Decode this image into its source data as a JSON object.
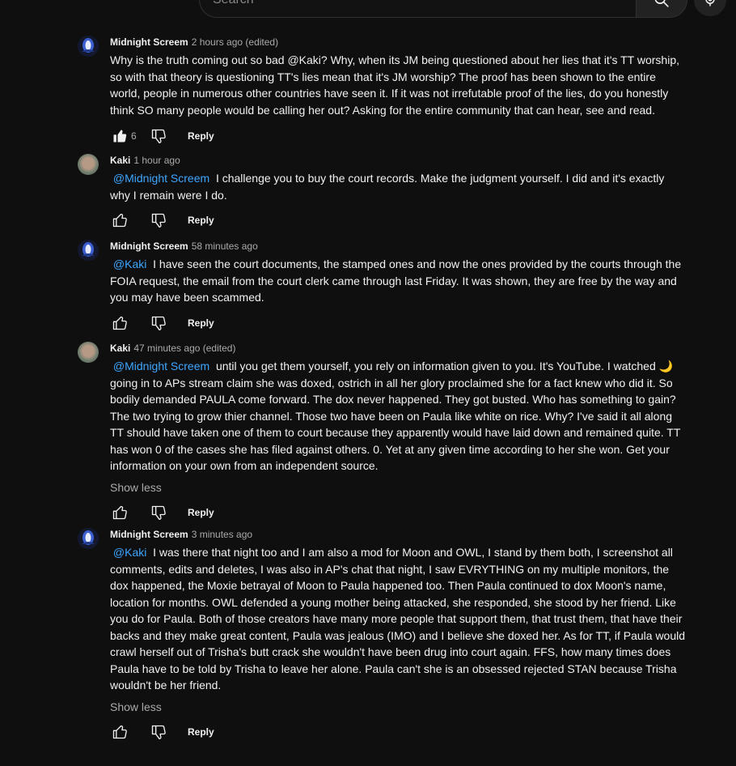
{
  "search": {
    "placeholder": "Search"
  },
  "comments": [
    {
      "author": "Midnight Screem",
      "meta": "2 hours ago (edited)",
      "mention": "",
      "text": "Why is the truth coming out so bad @Kaki? Why, when its JM being questioned about her lies that it's TT worship, so with that theory is questioning TT's lies mean that it's JM worship?  The proof has been shown to the entire world, people in numerous other countries have seen it. If it was not irrefutable proof of the lies, do you honestly think SO many people would be calling her out?  Asking for the entire community that can hear, see and read.",
      "likes": "6",
      "liked": true,
      "show_less": "",
      "reply": "Reply"
    },
    {
      "author": "Kaki",
      "meta": "1 hour ago",
      "mention": "@Midnight Screem",
      "text": "I challenge you to buy the court records. Make the judgment yourself. I did and it's exactly why I remain were I do.",
      "likes": "",
      "liked": false,
      "show_less": "",
      "reply": "Reply"
    },
    {
      "author": "Midnight Screem",
      "meta": "58 minutes ago",
      "mention": "@Kaki",
      "text": "I have seen the court documents, the stamped ones and now the ones  provided by the courts through the FOIA request, the email from the court clerk came through last Friday.  It was shown, they are free by the way and you may have been scammed.",
      "likes": "",
      "liked": false,
      "show_less": "",
      "reply": "Reply"
    },
    {
      "author": "Kaki",
      "meta": "47 minutes ago (edited)",
      "mention": "@Midnight Screem",
      "text": "until you get them yourself, you rely on information given to you. It's YouTube. I watched 🌙 going in to APs stream claim she was doxed, ostrich in all her glory proclaimed she for a fact knew who did it. So bodily demanded PAULA come forward. The dox never happened. They got busted. Who has something to gain? The two trying to grow thier channel. Those two have been on Paula like white on rice. Why? I've said it all along TT should have taken one of them to court because they apparently would have laid down and  remained quite. TT has won 0 of the cases she has filed against others. 0. Yet at any given time according to her she won. Get your information on your own from an independent source.",
      "likes": "",
      "liked": false,
      "show_less": "Show less",
      "reply": "Reply"
    },
    {
      "author": "Midnight Screem",
      "meta": "3 minutes ago",
      "mention": "@Kaki",
      "text": "I was there that night too and I am also a mod for Moon and OWL, I stand by them both, I screenshot all comments, edits and deletes, I was also in AP's chat that night, I saw EVRYTHING on my multiple monitors,  the dox happened, the Moxie betrayal of Moon  to Paula happened too. Then Paula continued to dox Moon's name, location for months. OWL defended a young mother being attacked, she responded, she stood by her friend. Like you do for Paula. Both of those creators have many more people that support them, that trust them, that have their backs  and they make great content, Paula was jealous  (IMO) and I believe she doxed her. As for TT, if Paula would crawl herself out of Trisha's butt crack she wouldn't have been drug into court again. FFS, how many times does Paula have to be told by Trisha to leave her alone. Paula can't she is an obsessed rejected STAN because Trisha wouldn't be her friend.",
      "likes": "",
      "liked": false,
      "show_less": "Show less",
      "reply": "Reply"
    }
  ]
}
